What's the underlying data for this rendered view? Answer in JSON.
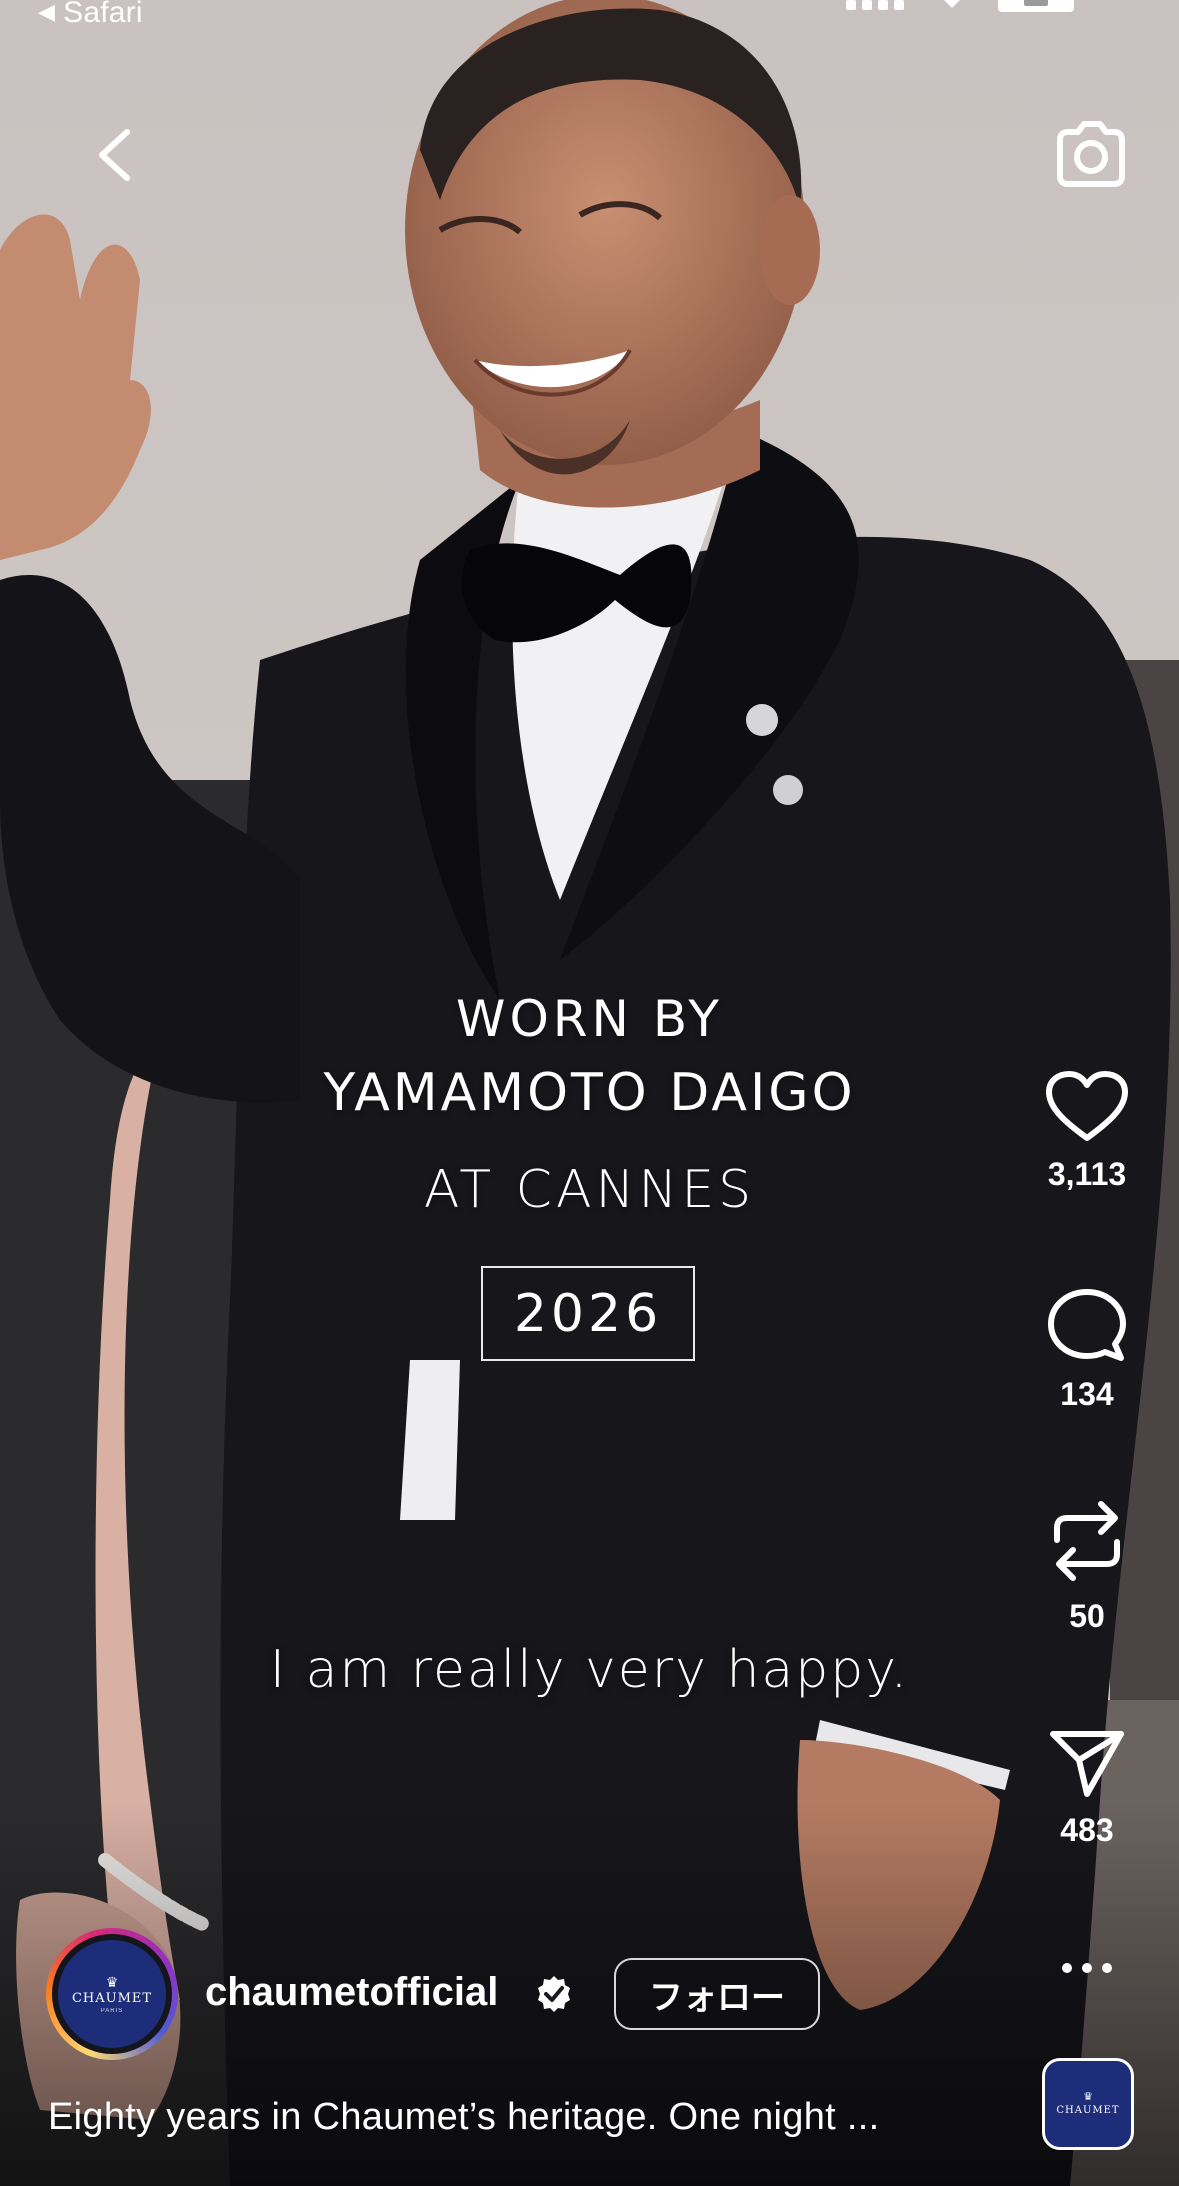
{
  "status_bar": {
    "back_app_label": "Safari",
    "back_app_icon": "back-triangle-icon",
    "signal_icon": "cellular-signal-icon",
    "wifi_icon": "wifi-icon",
    "battery_icon": "battery-icon"
  },
  "top_nav": {
    "back_icon": "chevron-left-icon",
    "camera_icon": "camera-icon"
  },
  "reel_overlay": {
    "line1": "WORN BY",
    "line2": "YAMAMOTO DAIGO",
    "line3": "AT CANNES",
    "year": "2026",
    "quote": "I am really very happy."
  },
  "actions": {
    "like": {
      "icon": "heart-icon",
      "count": "3,113"
    },
    "comment": {
      "icon": "comment-bubble-icon",
      "count": "134"
    },
    "repost": {
      "icon": "repost-icon",
      "count": "50"
    },
    "share": {
      "icon": "send-paper-plane-icon",
      "count": "483"
    },
    "more": {
      "icon": "more-dots-icon"
    }
  },
  "post": {
    "username": "chaumetofficial",
    "verified": true,
    "follow_label": "フォロー",
    "caption": "Eighty years in Chaumet’s heritage. One night ...",
    "avatar_brand": "CHAUMET",
    "avatar_city": "PARIS",
    "avatar_crest": "♛"
  },
  "colors": {
    "text": "#ffffff",
    "brand_navy": "#1d2d7a",
    "story_ring": [
      "#feda75",
      "#fa7e1e",
      "#d62976",
      "#962fbf",
      "#4f5bd5"
    ]
  }
}
